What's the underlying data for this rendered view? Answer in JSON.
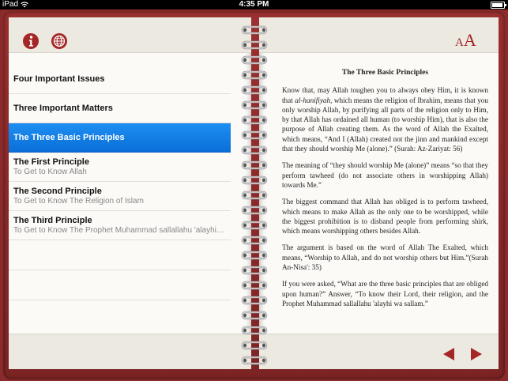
{
  "status_bar": {
    "carrier": "iPad",
    "time": "4:35 PM"
  },
  "left_toolbar": {
    "info_icon": "info-icon",
    "web_icon": "globe-icon"
  },
  "menu": [
    {
      "title": "Four Important Issues",
      "subtitle": ""
    },
    {
      "title": "Three Important Matters",
      "subtitle": ""
    },
    {
      "title": "The Three Basic Principles",
      "subtitle": "",
      "selected": true
    },
    {
      "title": "The First Principle",
      "subtitle": "To Get to Know Allah"
    },
    {
      "title": "The Second Principle",
      "subtitle": "To Get to Know The Religion of Islam"
    },
    {
      "title": "The Third Principle",
      "subtitle": "To Get to Know The Prophet Muhammad sallallahu 'alayhi wa sallam."
    }
  ],
  "font_button": {
    "small": "A",
    "large": "A"
  },
  "article": {
    "title": "The Three Basic Principles",
    "p1_a": "Know that, may Allah toughen you to always obey Him, it is known that ",
    "p1_em": "al-hanifiyah",
    "p1_b": ", which means the religion of Ibrahim, means that you only worship Allah, by purifying all parts of the religion only to Him, by that Allah has ordained all human (to worship Him), that is also the purpose of Allah creating them. As the word of Allah the Exalted, which means, “And I (Allah) created not the jinn and mankind except that they should worship Me (alone).” (Surah: Az-Zariyat: 56)",
    "p2": "The meaning of “they should worship Me (alone)” means “so that they perform tawheed (do not associate others in worshipping Allah) towards Me.”",
    "p3": "The biggest command that Allah has obliged is to perform tawheed, which means to make Allah as the only one to be worshipped, while the biggest prohibition is to disband people from performing shirk, which means worshipping others besides Allah.",
    "p4": "The argument is based on the word of Allah The Exalted, which means, “Worship to Allah, and do not worship others but Him.”(Surah An-Nisa': 35)",
    "p5": "If you were asked, “What are the three basic principles that are obliged upon human?” Answer, “To know their Lord, their religion, and the Prophet Muhammad sallallahu 'alayhi wa sallam.”"
  },
  "nav": {
    "prev_icon": "left-arrow-icon",
    "next_icon": "right-arrow-icon"
  },
  "colors": {
    "cover": "#8a2a2a",
    "accent": "#a02424",
    "selection": "#0a6fd8",
    "page": "#fbfaf7"
  }
}
